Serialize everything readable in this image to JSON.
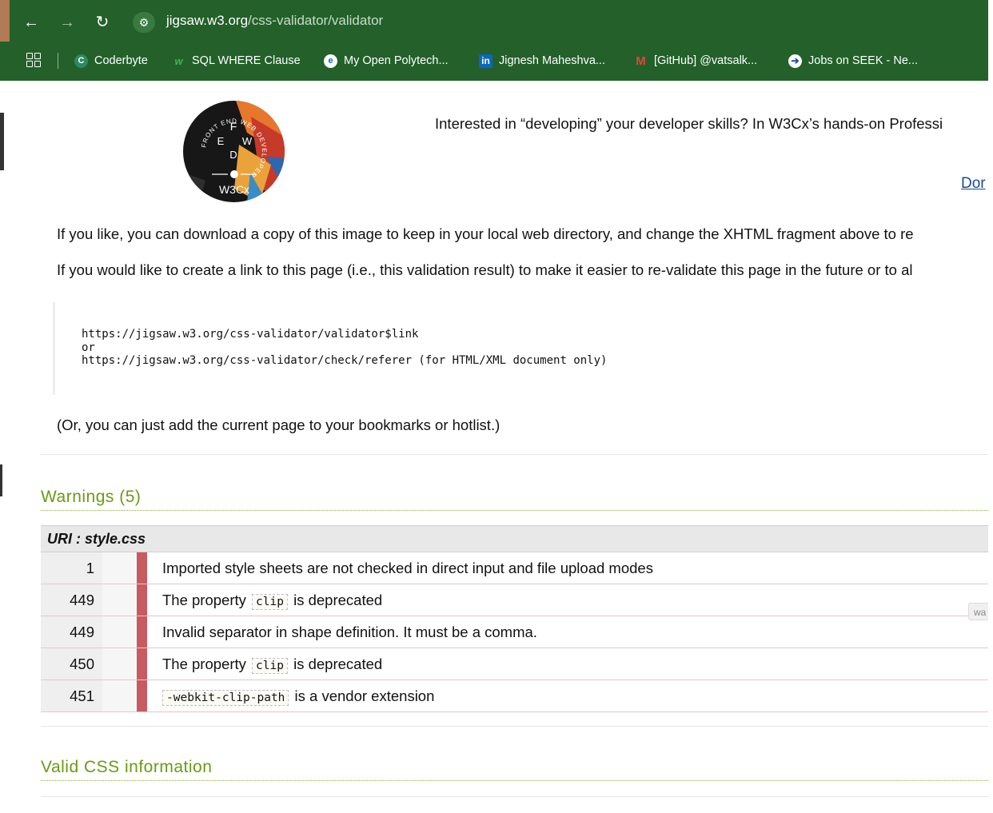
{
  "browser": {
    "url_host": "jigsaw.w3.org",
    "url_path": "/css-validator/validator",
    "bookmarks": [
      {
        "label": "Coderbyte",
        "icon": "coderbyte-icon"
      },
      {
        "label": "SQL WHERE Clause",
        "icon": "w3schools-icon"
      },
      {
        "label": "My Open Polytech...",
        "icon": "polytech-icon"
      },
      {
        "label": "Jignesh Maheshva...",
        "icon": "linkedin-icon"
      },
      {
        "label": "[GitHub] @vatsalk...",
        "icon": "gmail-icon"
      },
      {
        "label": "Jobs on SEEK - Ne...",
        "icon": "seek-icon"
      }
    ]
  },
  "promo": {
    "logo_letters": [
      "F",
      "E",
      "W",
      "D"
    ],
    "logo_ring_text": "FRONT END WEB DEVELOPER",
    "logo_brand": "W3Cx",
    "text": "Interested in “developing” your developer skills? In W3Cx’s hands-on Professi",
    "donate_link": "Dor"
  },
  "content": {
    "para1": "If you like, you can download a copy of this image to keep in your local web directory, and change the XHTML fragment above to re",
    "para2": "If you would like to create a link to this page (i.e., this validation result) to make it easier to re-validate this page in the future or to al",
    "code_lines": [
      "https://jigsaw.w3.org/css-validator/validator$link",
      "or",
      "https://jigsaw.w3.org/css-validator/check/referer (for HTML/XML document only)"
    ],
    "bookmark_note": "(Or, you can just add the current page to your bookmarks or hotlist.)"
  },
  "warnings": {
    "title": "Warnings (5)",
    "uri": "URI : style.css",
    "rows": [
      {
        "line": "1",
        "pre": "Imported style sheets are not checked in direct input and file upload modes",
        "code": "",
        "post": ""
      },
      {
        "line": "449",
        "pre": "The property",
        "code": "clip",
        "post": "is deprecated"
      },
      {
        "line": "449",
        "pre": "Invalid separator in shape definition. It must be a comma.",
        "code": "",
        "post": ""
      },
      {
        "line": "450",
        "pre": "The property",
        "code": "clip",
        "post": "is deprecated"
      },
      {
        "line": "451",
        "pre": "",
        "code": "-webkit-clip-path",
        "post": "is a vendor extension"
      }
    ],
    "tooltip": "wa"
  },
  "valid_css": {
    "title": "Valid CSS information"
  }
}
